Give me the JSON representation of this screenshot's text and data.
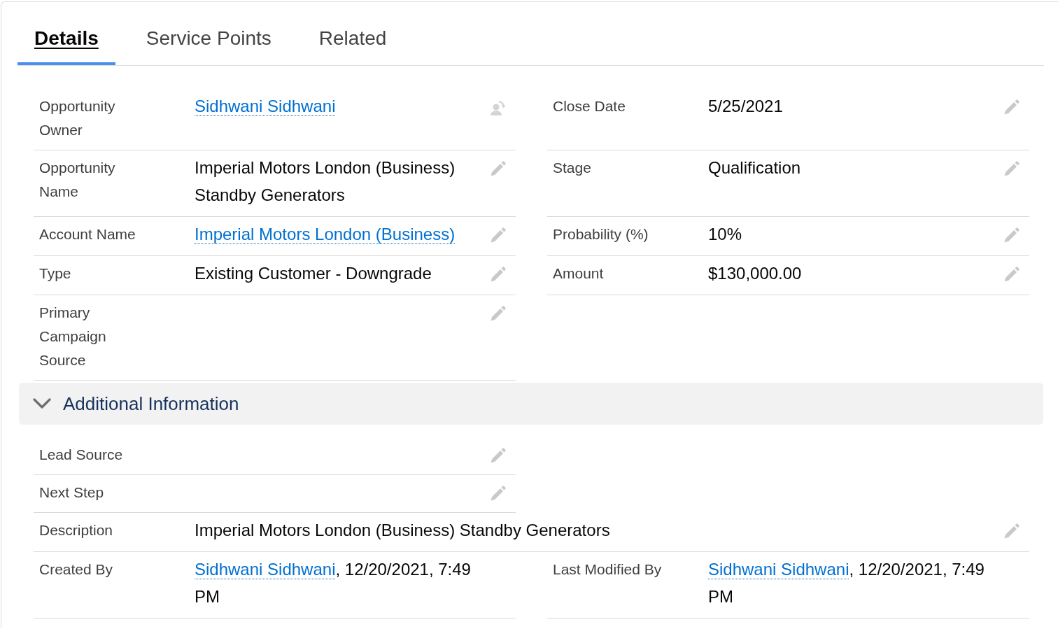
{
  "tabs": [
    {
      "label": "Details",
      "selected": true
    },
    {
      "label": "Service Points",
      "selected": false
    },
    {
      "label": "Related",
      "selected": false
    }
  ],
  "sections": [
    {
      "rows": [
        {
          "left": {
            "label": "Opportunity Owner",
            "kind": "owner",
            "value": "Sidhwani Sidhwani",
            "editable": true
          },
          "right": {
            "label": "Close Date",
            "kind": "text",
            "value": "5/25/2021",
            "editable": true
          }
        },
        {
          "left": {
            "label": "Opportunity Name",
            "kind": "text",
            "value": "Imperial Motors London (Business) Standby Generators",
            "editable": true
          },
          "right": {
            "label": "Stage",
            "kind": "text",
            "value": "Qualification",
            "editable": true
          }
        },
        {
          "left": {
            "label": "Account Name",
            "kind": "link",
            "value": "Imperial Motors London (Business)",
            "editable": true
          },
          "right": {
            "label": "Probability (%)",
            "kind": "text",
            "value": "10%",
            "editable": true
          }
        },
        {
          "left": {
            "label": "Type",
            "kind": "text",
            "value": "Existing Customer - Downgrade",
            "editable": true
          },
          "right": {
            "label": "Amount",
            "kind": "text",
            "value": "$130,000.00",
            "editable": true
          }
        },
        {
          "left": {
            "label": "Primary Campaign Source",
            "kind": "text",
            "editable": true
          }
        }
      ]
    },
    {
      "title": "Additional Information",
      "expanded": true,
      "rows": [
        {
          "left": {
            "label": "Lead Source",
            "kind": "text",
            "editable": true
          }
        },
        {
          "left": {
            "label": "Next Step",
            "kind": "text",
            "editable": true
          }
        },
        {
          "full": {
            "label": "Description",
            "kind": "text",
            "value": "Imperial Motors London (Business) Standby Generators",
            "editable": true
          }
        },
        {
          "left": {
            "label": "Created By",
            "kind": "link",
            "value": "Sidhwani Sidhwani",
            "suffix": ", 12/20/2021, 7:49 PM",
            "editable": false
          },
          "right": {
            "label": "Last Modified By",
            "kind": "link",
            "value": "Sidhwani Sidhwani",
            "suffix": ", 12/20/2021, 7:49 PM",
            "editable": false
          }
        }
      ]
    }
  ]
}
